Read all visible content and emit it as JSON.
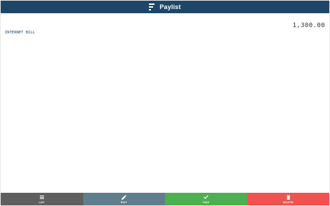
{
  "app": {
    "title": "Paylist"
  },
  "bill": {
    "name": "INTERNET BILL",
    "amount": "1,300.00"
  },
  "toolbar": {
    "list": {
      "label": "LIST",
      "icon": "list-icon"
    },
    "edit": {
      "label": "EDIT",
      "icon": "pencil-icon"
    },
    "paid": {
      "label": "PAID",
      "icon": "check-icon"
    },
    "delete": {
      "label": "DELETE",
      "icon": "trash-icon"
    }
  },
  "colors": {
    "header": "#1e4668",
    "list_button": "#5f5f5f",
    "edit_button": "#607d8b",
    "paid_button": "#4caf50",
    "delete_button": "#ef5350"
  }
}
